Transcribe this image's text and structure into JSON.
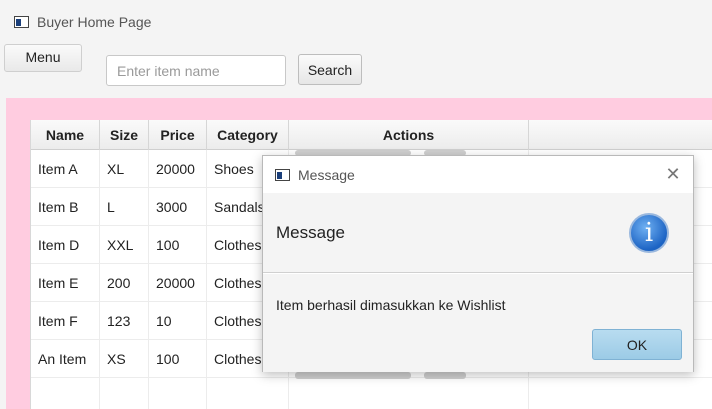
{
  "window": {
    "title": "Buyer Home Page"
  },
  "toolbar": {
    "menu_label": "Menu",
    "search_placeholder": "Enter item name",
    "search_value": "",
    "search_label": "Search"
  },
  "table": {
    "columns": [
      "Name",
      "Size",
      "Price",
      "Category",
      "Actions"
    ],
    "rows": [
      {
        "name": "Item A",
        "size": "XL",
        "price": "20000",
        "category": "Shoes"
      },
      {
        "name": "Item B",
        "size": "L",
        "price": "3000",
        "category": "Sandals"
      },
      {
        "name": "Item D",
        "size": "XXL",
        "price": "100",
        "category": "Clothes"
      },
      {
        "name": "Item E",
        "size": "200",
        "price": "20000",
        "category": "Clothes"
      },
      {
        "name": "Item F",
        "size": "123",
        "price": "10",
        "category": "Clothes"
      },
      {
        "name": "An Item",
        "size": "XS",
        "price": "100",
        "category": "Clothes"
      }
    ]
  },
  "dialog": {
    "title": "Message",
    "header": "Message",
    "content": "Item berhasil dimasukkan ke Wishlist",
    "ok_label": "OK",
    "icon": "info-icon"
  },
  "colors": {
    "panel_background": "#ffcce0",
    "ok_button": "#9ccbe6",
    "info_icon": "#1d64c4"
  }
}
